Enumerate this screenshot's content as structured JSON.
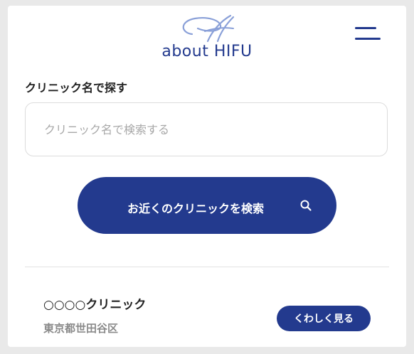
{
  "header": {
    "logo_text": "about HIFU",
    "logo_icon": "script-h-logo-icon",
    "menu_icon": "hamburger-menu-icon"
  },
  "search": {
    "section_title": "クリニック名で探す",
    "placeholder": "クリニック名で検索する",
    "value": "",
    "nearby_button_label": "お近くのクリニックを検索",
    "nearby_button_icon": "search-icon"
  },
  "results": [
    {
      "name": "○○○○クリニック",
      "address": "東京都世田谷区",
      "detail_label": "くわしく見る"
    }
  ],
  "colors": {
    "brand": "#233a8e",
    "logo_accent": "#8aa0d8",
    "text": "#222222",
    "muted_text": "#8a8a8a",
    "border": "#dcdcdc"
  }
}
